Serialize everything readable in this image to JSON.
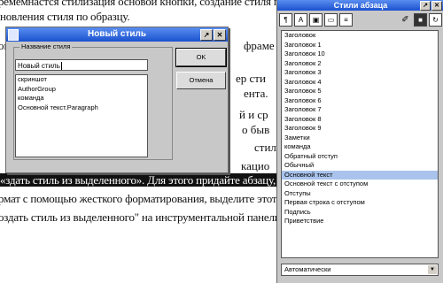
{
  "document": {
    "lines": [
      "ремемнастся стилизация основой кнопки, создание стиля по",
      "новления стиля по образцу.",
      "ов",
      "фраме",
      "ер сти",
      "ента.",
      "й и ср",
      "о быв",
      "стил",
      "кацио",
      "«здать стиль из выделенного». Для этого придайте абзацу, символу",
      "рмат с помощью жесткого форматирования, выделите этот формат",
      "оздать стиль из выделенного\" на инструментальной панели Мастер"
    ]
  },
  "dialog": {
    "title": "Новый стиль",
    "group_label": "Название стиля",
    "name_value": "Новый стиль",
    "list_items": [
      "скриншот",
      "AuthorGroup",
      "команда",
      "Основной текст.Paragraph"
    ],
    "ok_label": "OK",
    "cancel_label": "Отмена",
    "icons": {
      "window": "document-icon",
      "pin": "pin-icon",
      "close": "close-icon"
    }
  },
  "panel": {
    "title": "Стили абзаца",
    "toolbar_icons": [
      "paragraph-styles-icon",
      "character-styles-icon",
      "frame-styles-icon",
      "page-styles-icon",
      "list-styles-icon",
      "fill-format-icon",
      "new-style-icon",
      "update-style-icon"
    ],
    "styles": [
      "Заголовок",
      "Заголовок 1",
      "Заголовок 10",
      "Заголовок 2",
      "Заголовок 3",
      "Заголовок 4",
      "Заголовок 5",
      "Заголовок 6",
      "Заголовок 7",
      "Заголовок 8",
      "Заголовок 9",
      "Заметки",
      "команда",
      "Обратный отступ",
      "Обычный",
      "Основной текст",
      "Основной текст с отступом",
      "Отступы",
      "Первая строка с отступом",
      "Подпись",
      "Приветствие"
    ],
    "selected_index": 15,
    "filter_value": "Автоматически"
  }
}
